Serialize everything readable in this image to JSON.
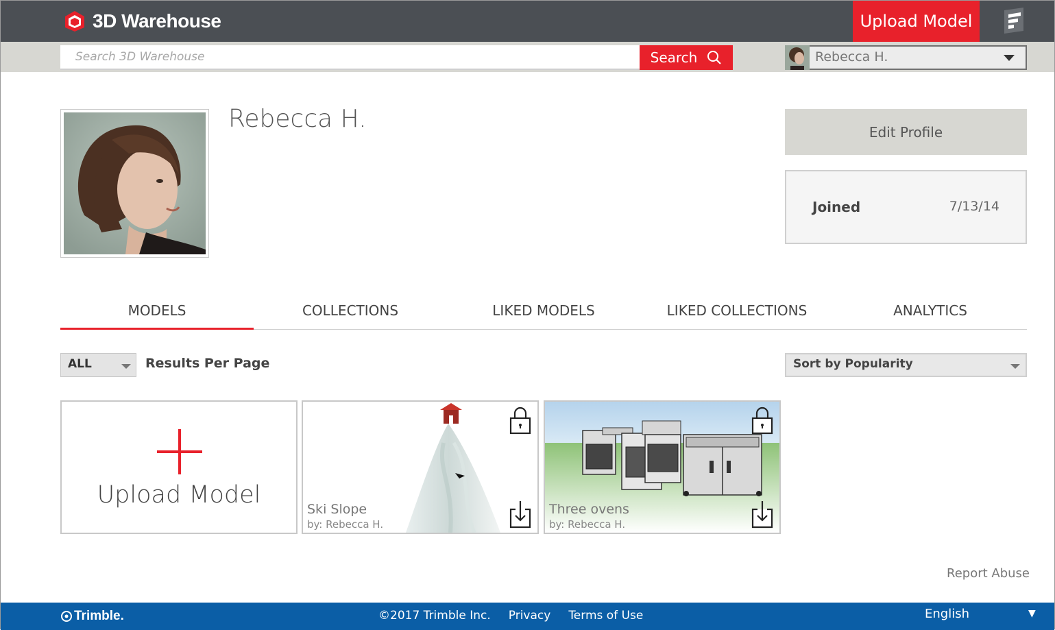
{
  "header": {
    "logo_text": "3D Warehouse",
    "upload_label": "Upload Model"
  },
  "search": {
    "placeholder": "Search 3D Warehouse",
    "button_label": "Search"
  },
  "user_menu": {
    "name": "Rebecca H."
  },
  "profile": {
    "name": "Rebecca H.",
    "edit_label": "Edit Profile",
    "joined_label": "Joined",
    "joined_value": "7/13/14"
  },
  "tabs": [
    {
      "label": "MODELS",
      "active": true
    },
    {
      "label": "COLLECTIONS",
      "active": false
    },
    {
      "label": "LIKED MODELS",
      "active": false
    },
    {
      "label": "LIKED COLLECTIONS",
      "active": false
    },
    {
      "label": "ANALYTICS",
      "active": false
    }
  ],
  "filters": {
    "results_value": "ALL",
    "results_label": "Results Per Page",
    "sort_value": "Sort by Popularity"
  },
  "cards": {
    "upload_label": "Upload Model",
    "models": [
      {
        "title": "Ski Slope",
        "author": "by: Rebecca H."
      },
      {
        "title": "Three ovens",
        "author": "by: Rebecca H."
      }
    ]
  },
  "report_abuse": "Report Abuse",
  "footer": {
    "brand": "Trimble.",
    "copyright": "©2017 Trimble Inc.",
    "privacy": "Privacy",
    "terms": "Terms of Use",
    "language": "English",
    "language_caret": "▼"
  },
  "colors": {
    "accent": "#e8212b",
    "header_bg": "#4b4f54",
    "footer_bg": "#0b5ea6"
  }
}
